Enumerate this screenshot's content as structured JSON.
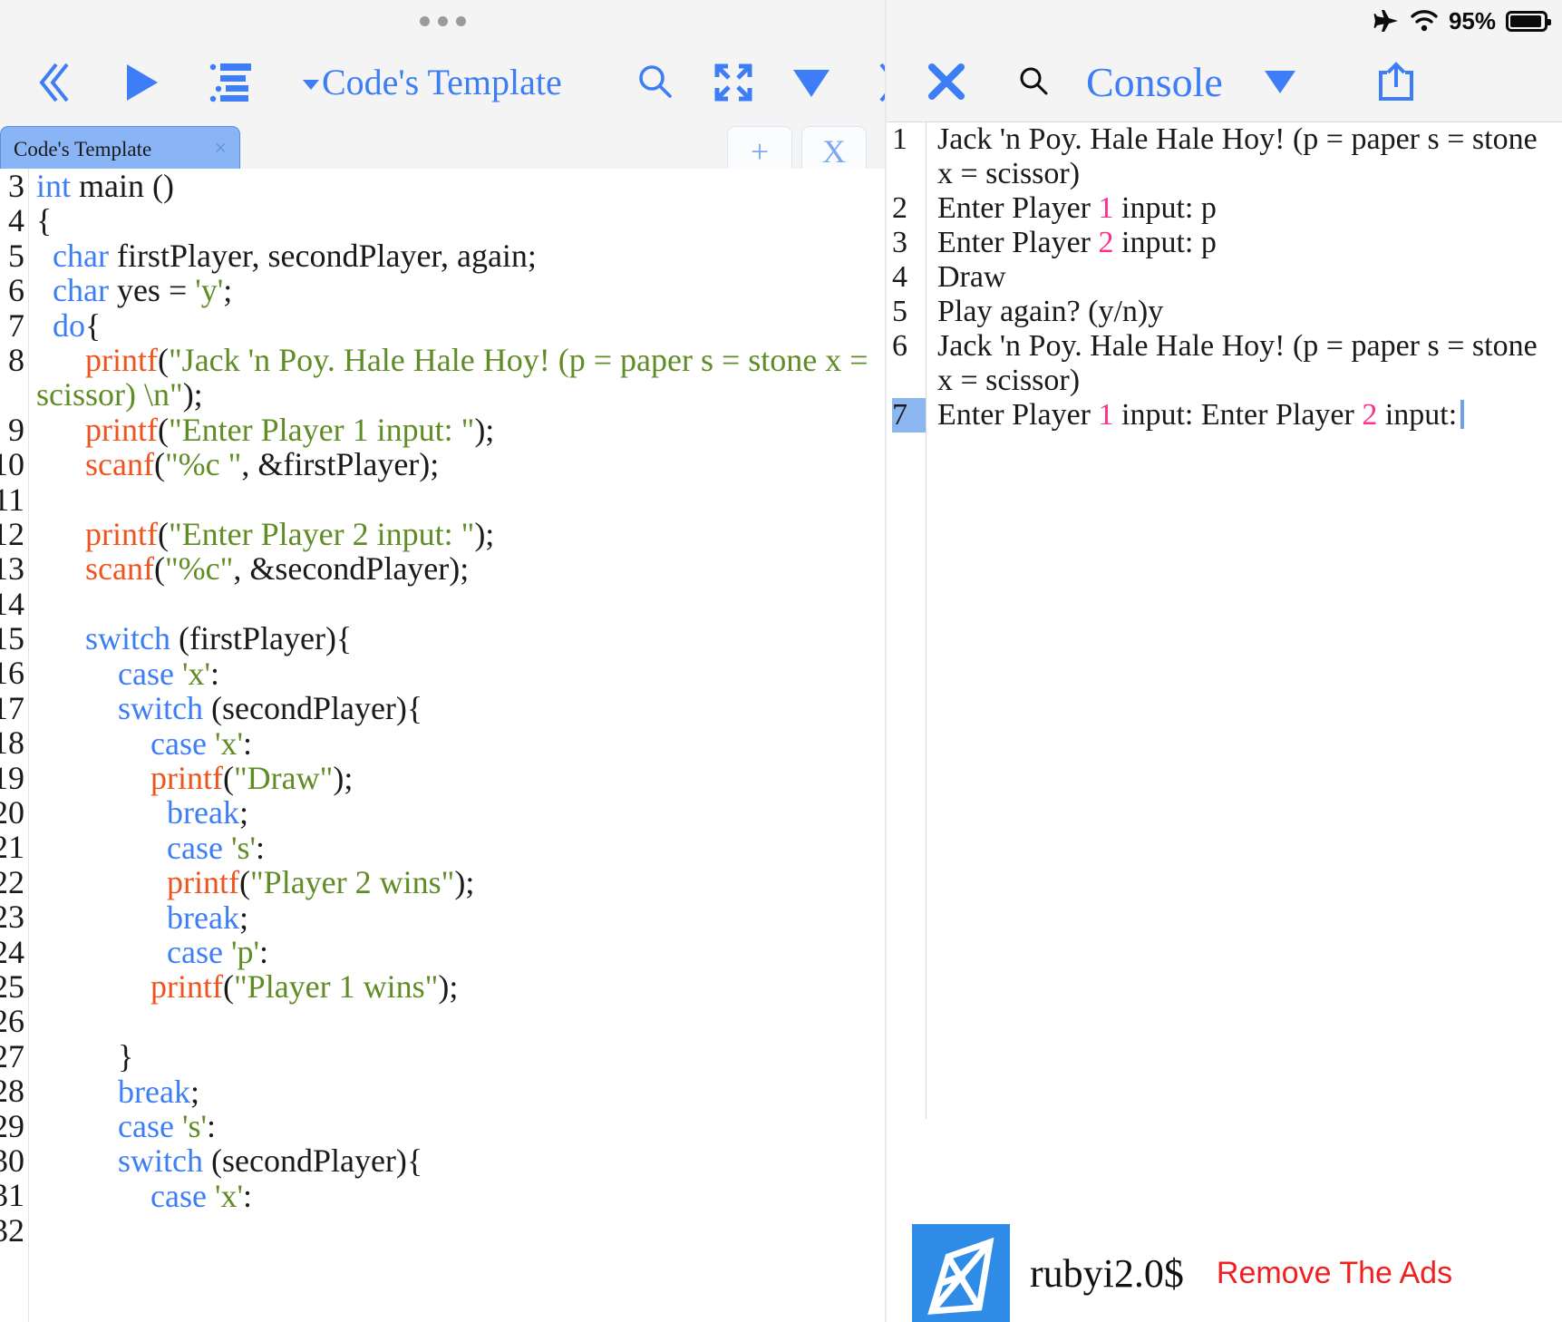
{
  "editor": {
    "toolbar": {
      "collapse_left_label": "≪",
      "run_label": "▶",
      "outline_label": "list-outline",
      "title": "Code's Template",
      "search_label": "search",
      "fullscreen_label": "expand",
      "dropdown_label": "▼",
      "collapse_right_label": "⟫"
    },
    "tabs": [
      {
        "label": "Code's Template",
        "close_label": "×",
        "active": true
      }
    ],
    "tab_actions": {
      "new_label": "+",
      "close_label": "X"
    },
    "line_numbers": [
      "3",
      "4",
      "5",
      "6",
      "7",
      "8",
      "",
      "9",
      "10",
      "11",
      "12",
      "13",
      "14",
      "15",
      "16",
      "17",
      "18",
      "19",
      "20",
      "21",
      "22",
      "23",
      "24",
      "25",
      "26",
      "27",
      "28",
      "29",
      "30",
      "31",
      "32"
    ],
    "code": [
      {
        "tokens": [
          {
            "t": "int",
            "c": "kw"
          },
          {
            "t": " main ()",
            "c": "pl"
          }
        ]
      },
      {
        "tokens": [
          {
            "t": "{",
            "c": "pl"
          }
        ],
        "indent": 0
      },
      {
        "tokens": [
          {
            "t": "char",
            "c": "kw"
          },
          {
            "t": " firstPlayer, secondPlayer, again;",
            "c": "pl"
          }
        ],
        "indent": 1
      },
      {
        "tokens": [
          {
            "t": "char",
            "c": "kw"
          },
          {
            "t": " yes = ",
            "c": "pl"
          },
          {
            "t": "'y'",
            "c": "str"
          },
          {
            "t": ";",
            "c": "pl"
          }
        ],
        "indent": 1
      },
      {
        "tokens": [
          {
            "t": "do",
            "c": "kw"
          },
          {
            "t": "{",
            "c": "pl"
          }
        ],
        "indent": 1
      },
      {
        "tokens": [
          {
            "t": "printf",
            "c": "fn"
          },
          {
            "t": "(",
            "c": "pl"
          },
          {
            "t": "\"Jack 'n Poy. Hale Hale Hoy! (p = paper s = stone x = scissor) \\n\"",
            "c": "str"
          },
          {
            "t": ");",
            "c": "pl"
          }
        ],
        "indent": 3
      },
      {
        "tokens": [
          {
            "t": "printf",
            "c": "fn"
          },
          {
            "t": "(",
            "c": "pl"
          },
          {
            "t": "\"Enter Player 1 input: \"",
            "c": "str"
          },
          {
            "t": ");",
            "c": "pl"
          }
        ],
        "indent": 3
      },
      {
        "tokens": [
          {
            "t": "scanf",
            "c": "fn"
          },
          {
            "t": "(",
            "c": "pl"
          },
          {
            "t": "\"%c \"",
            "c": "str"
          },
          {
            "t": ", &firstPlayer);",
            "c": "pl"
          }
        ],
        "indent": 3
      },
      {
        "tokens": [],
        "indent": 0
      },
      {
        "tokens": [
          {
            "t": "printf",
            "c": "fn"
          },
          {
            "t": "(",
            "c": "pl"
          },
          {
            "t": "\"Enter Player 2 input: \"",
            "c": "str"
          },
          {
            "t": ");",
            "c": "pl"
          }
        ],
        "indent": 3
      },
      {
        "tokens": [
          {
            "t": "scanf",
            "c": "fn"
          },
          {
            "t": "(",
            "c": "pl"
          },
          {
            "t": "\"%c\"",
            "c": "str"
          },
          {
            "t": ", &secondPlayer);",
            "c": "pl"
          }
        ],
        "indent": 3
      },
      {
        "tokens": [],
        "indent": 0
      },
      {
        "tokens": [
          {
            "t": "switch",
            "c": "kw"
          },
          {
            "t": " (firstPlayer){",
            "c": "pl"
          }
        ],
        "indent": 3
      },
      {
        "tokens": [
          {
            "t": "case",
            "c": "kw"
          },
          {
            "t": " ",
            "c": "pl"
          },
          {
            "t": "'x'",
            "c": "str"
          },
          {
            "t": ":",
            "c": "pl"
          }
        ],
        "indent": 5
      },
      {
        "tokens": [
          {
            "t": "switch",
            "c": "kw"
          },
          {
            "t": " (secondPlayer){",
            "c": "pl"
          }
        ],
        "indent": 5
      },
      {
        "tokens": [
          {
            "t": "case",
            "c": "kw"
          },
          {
            "t": " ",
            "c": "pl"
          },
          {
            "t": "'x'",
            "c": "str"
          },
          {
            "t": ":",
            "c": "pl"
          }
        ],
        "indent": 7
      },
      {
        "tokens": [
          {
            "t": "printf",
            "c": "fn"
          },
          {
            "t": "(",
            "c": "pl"
          },
          {
            "t": "\"Draw\"",
            "c": "str"
          },
          {
            "t": ");",
            "c": "pl"
          }
        ],
        "indent": 7
      },
      {
        "tokens": [
          {
            "t": "break",
            "c": "kw"
          },
          {
            "t": ";",
            "c": "pl"
          }
        ],
        "indent": 8
      },
      {
        "tokens": [
          {
            "t": "case",
            "c": "kw"
          },
          {
            "t": " ",
            "c": "pl"
          },
          {
            "t": "'s'",
            "c": "str"
          },
          {
            "t": ":",
            "c": "pl"
          }
        ],
        "indent": 8
      },
      {
        "tokens": [
          {
            "t": "printf",
            "c": "fn"
          },
          {
            "t": "(",
            "c": "pl"
          },
          {
            "t": "\"Player 2 wins\"",
            "c": "str"
          },
          {
            "t": ");",
            "c": "pl"
          }
        ],
        "indent": 8
      },
      {
        "tokens": [
          {
            "t": "break",
            "c": "kw"
          },
          {
            "t": ";",
            "c": "pl"
          }
        ],
        "indent": 8
      },
      {
        "tokens": [
          {
            "t": "case",
            "c": "kw"
          },
          {
            "t": " ",
            "c": "pl"
          },
          {
            "t": "'p'",
            "c": "str"
          },
          {
            "t": ":",
            "c": "pl"
          }
        ],
        "indent": 8
      },
      {
        "tokens": [
          {
            "t": "printf",
            "c": "fn"
          },
          {
            "t": "(",
            "c": "pl"
          },
          {
            "t": "\"Player 1 wins\"",
            "c": "str"
          },
          {
            "t": ");",
            "c": "pl"
          }
        ],
        "indent": 7
      },
      {
        "tokens": [],
        "indent": 0
      },
      {
        "tokens": [
          {
            "t": "}",
            "c": "pl"
          }
        ],
        "indent": 5
      },
      {
        "tokens": [
          {
            "t": "break",
            "c": "kw"
          },
          {
            "t": ";",
            "c": "pl"
          }
        ],
        "indent": 5
      },
      {
        "tokens": [
          {
            "t": "case",
            "c": "kw"
          },
          {
            "t": " ",
            "c": "pl"
          },
          {
            "t": "'s'",
            "c": "str"
          },
          {
            "t": ":",
            "c": "pl"
          }
        ],
        "indent": 5
      },
      {
        "tokens": [
          {
            "t": "switch",
            "c": "kw"
          },
          {
            "t": " (secondPlayer){",
            "c": "pl"
          }
        ],
        "indent": 5
      },
      {
        "tokens": [
          {
            "t": "case",
            "c": "kw"
          },
          {
            "t": " ",
            "c": "pl"
          },
          {
            "t": "'x'",
            "c": "str"
          },
          {
            "t": ":",
            "c": "pl"
          }
        ],
        "indent": 7
      }
    ]
  },
  "console": {
    "statusbar": {
      "airplane": "airplane-mode",
      "wifi": "wifi",
      "battery_pct": "95%"
    },
    "toolbar": {
      "close_label": "✕",
      "search_label": "search",
      "title": "Console",
      "dropdown_label": "▼",
      "share_label": "share"
    },
    "lines": [
      {
        "num": "1",
        "active": false,
        "parts": [
          {
            "t": "Jack 'n Poy. Hale Hale Hoy! (p = paper s = stone x = scissor)",
            "c": "plain"
          }
        ]
      },
      {
        "num": "2",
        "active": false,
        "parts": [
          {
            "t": "Enter Player ",
            "c": "plain"
          },
          {
            "t": "1",
            "c": "pink"
          },
          {
            "t": " input: p",
            "c": "plain"
          }
        ]
      },
      {
        "num": "3",
        "active": false,
        "parts": [
          {
            "t": "Enter Player ",
            "c": "plain"
          },
          {
            "t": "2",
            "c": "pink"
          },
          {
            "t": " input: p",
            "c": "plain"
          }
        ]
      },
      {
        "num": "4",
        "active": false,
        "parts": [
          {
            "t": "Draw",
            "c": "plain"
          }
        ]
      },
      {
        "num": "5",
        "active": false,
        "parts": [
          {
            "t": "Play again? (y/n)y",
            "c": "plain"
          }
        ]
      },
      {
        "num": "6",
        "active": false,
        "parts": [
          {
            "t": "Jack 'n Poy. Hale Hale Hoy! (p = paper s = stone x = scissor)",
            "c": "plain"
          }
        ]
      },
      {
        "num": "7",
        "active": true,
        "cursor": true,
        "parts": [
          {
            "t": "Enter Player ",
            "c": "plain"
          },
          {
            "t": "1",
            "c": "pink"
          },
          {
            "t": " input: Enter Player ",
            "c": "plain"
          },
          {
            "t": "2",
            "c": "pink"
          },
          {
            "t": " input:",
            "c": "plain"
          }
        ]
      }
    ]
  },
  "ad": {
    "logo_label": "rubyi-logo",
    "name": "rubyi2.0$",
    "remove_label": "Remove The Ads"
  },
  "colors": {
    "accent_blue": "#3d7ef7",
    "tab_blue": "#89b4f5",
    "keyword": "#3d7ef7",
    "string": "#5f8c25",
    "function": "#f0541e",
    "pink": "#ff2d8e",
    "ad_red": "#f02020",
    "chrome_gray": "#f4f4f4"
  }
}
